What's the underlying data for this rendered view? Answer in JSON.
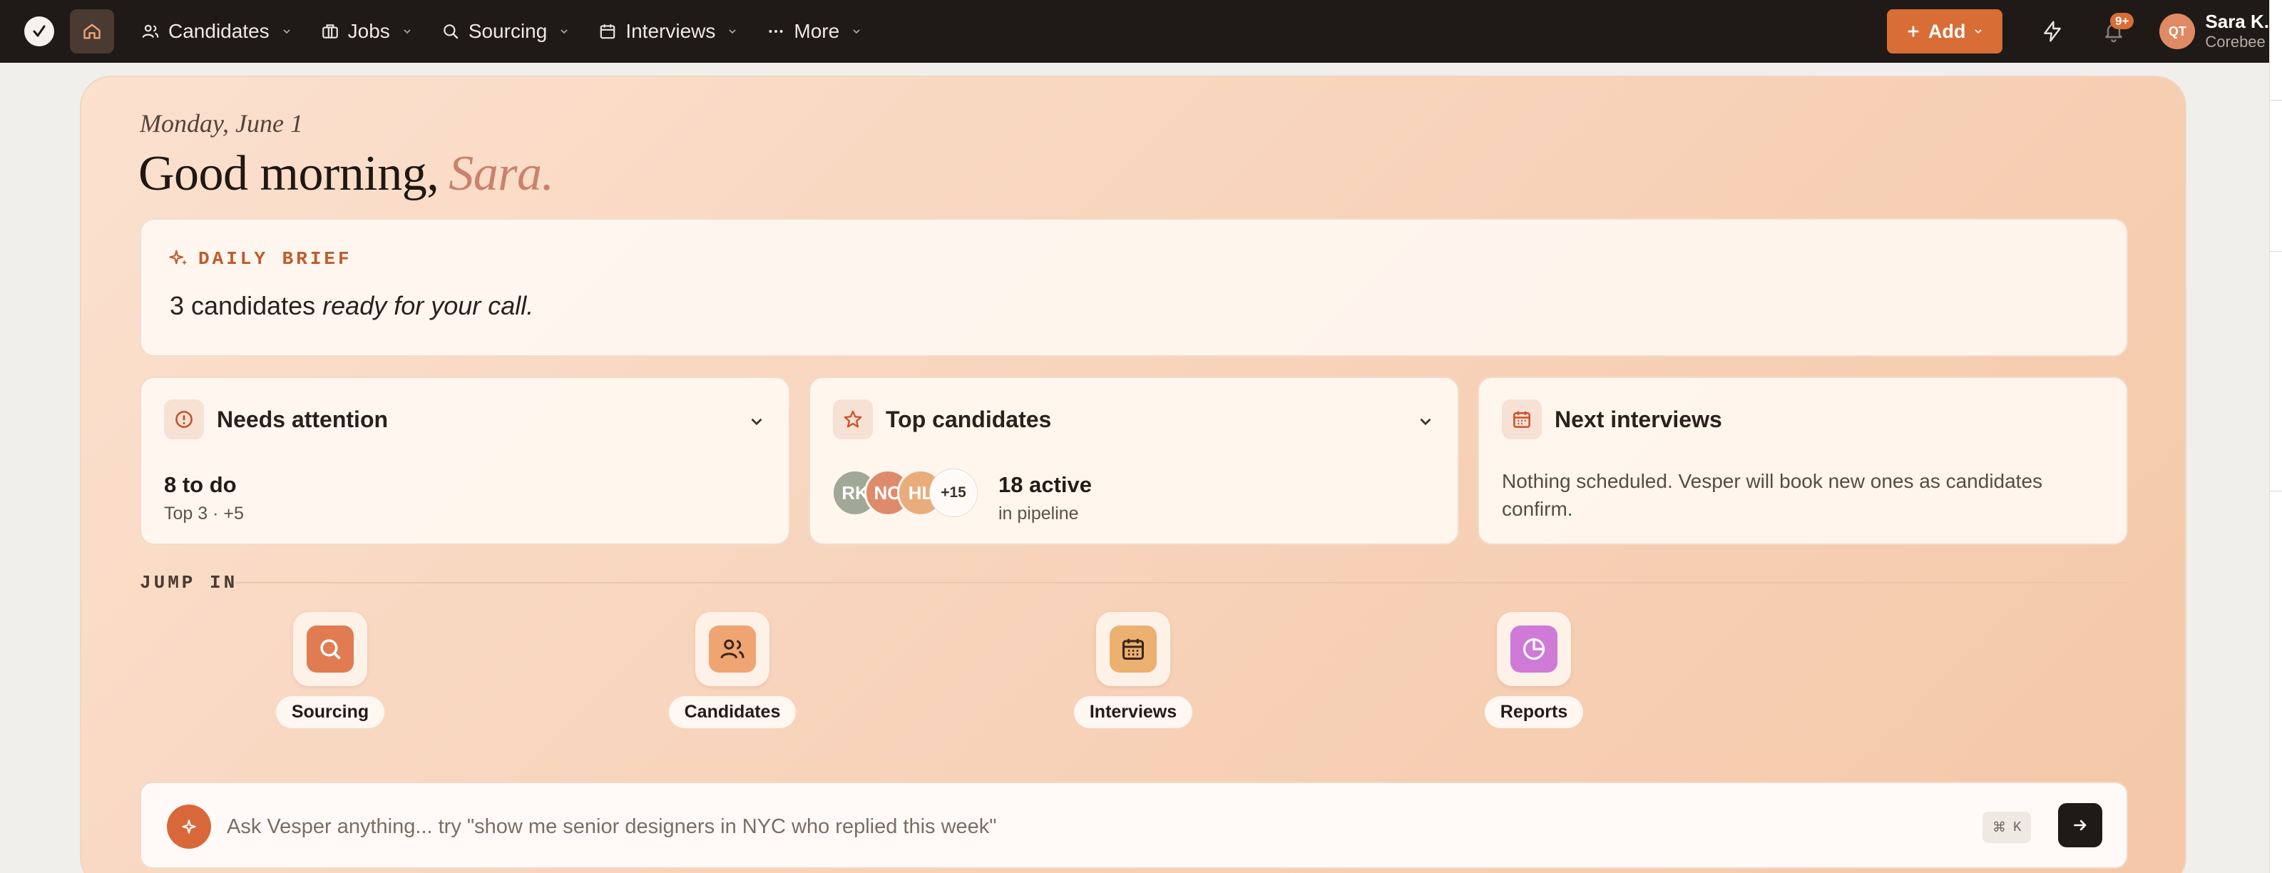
{
  "nav": {
    "items": [
      {
        "label": "Candidates",
        "icon": "users-icon"
      },
      {
        "label": "Jobs",
        "icon": "briefcase-icon"
      },
      {
        "label": "Sourcing",
        "icon": "search-icon"
      },
      {
        "label": "Interviews",
        "icon": "calendar-icon"
      },
      {
        "label": "More",
        "icon": "ellipsis-icon"
      }
    ],
    "add_label": "Add",
    "notification_count": "9+",
    "user": {
      "initials": "QT",
      "name": "Sara K.",
      "org": "Corebee"
    }
  },
  "hero": {
    "date": "Monday, June 1",
    "greeting_prefix": "Good morning,",
    "greeting_name": "Sara."
  },
  "brief": {
    "label": "DAILY BRIEF",
    "text_plain": "3 candidates",
    "text_italic": "ready for your call."
  },
  "cards": {
    "attention": {
      "title": "Needs attention",
      "main": "8 to do",
      "sub": "Top 3 · +5"
    },
    "top": {
      "title": "Top candidates",
      "avatars": [
        {
          "initials": "RK",
          "color": "#a1a896"
        },
        {
          "initials": "NO",
          "color": "#de8b6c"
        },
        {
          "initials": "HL",
          "color": "#e9ad7c"
        }
      ],
      "more": "+15",
      "main": "18 active",
      "sub": "in pipeline"
    },
    "interviews": {
      "title": "Next interviews",
      "text": "Nothing scheduled. Vesper will book new ones as candidates confirm."
    }
  },
  "jump": {
    "label": "JUMP IN",
    "tiles": [
      {
        "label": "Sourcing",
        "icon": "search-icon",
        "color": "#e07b52"
      },
      {
        "label": "Candidates",
        "icon": "users-icon",
        "color": "#efa572"
      },
      {
        "label": "Interviews",
        "icon": "calendar-icon",
        "color": "#ecb070"
      },
      {
        "label": "Reports",
        "icon": "pie-chart-icon",
        "color": "#cf7ad6"
      }
    ]
  },
  "ask": {
    "placeholder": "Ask Vesper anything... try \"show me senior designers in NYC who replied this week\"",
    "shortcut_symbol": "⌘",
    "shortcut_key": "K"
  },
  "colors": {
    "accent": "#d86d35",
    "nav_bg": "#1f1a17"
  }
}
